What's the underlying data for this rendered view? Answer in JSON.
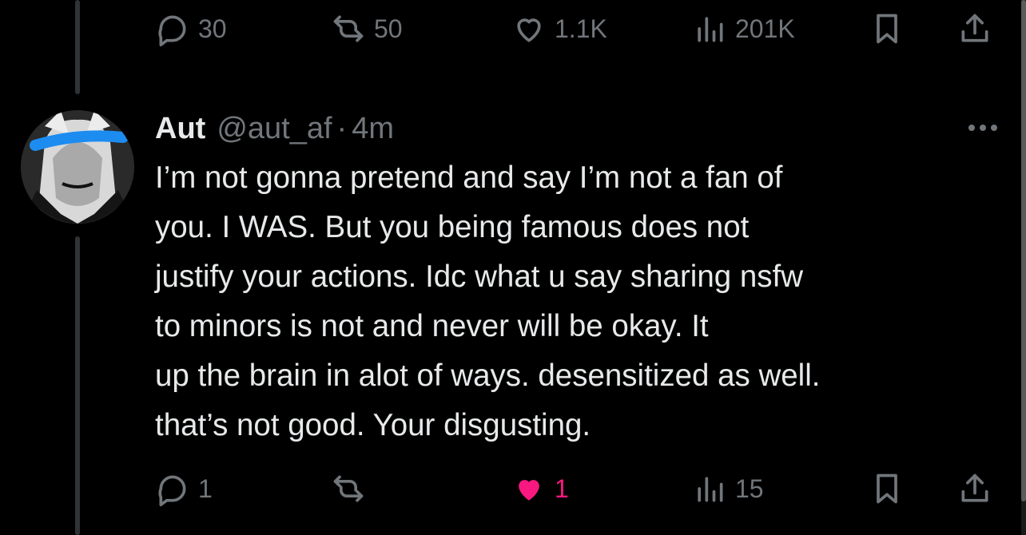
{
  "parent_actions": {
    "reply_count": "30",
    "retweet_count": "50",
    "like_count": "1.1K",
    "view_count": "201K"
  },
  "tweet": {
    "name": "Aut",
    "handle": "@aut_af",
    "separator": "·",
    "time": "4m",
    "text_lines": [
      "I’m not gonna pretend and say I’m not a fan of",
      "you. I WAS. But you being famous does not",
      "justify your actions. Idc what u say sharing nsfw",
      "to minors is not and never will be okay. It",
      "up the brain in alot of ways. desensitized as well.",
      "that’s not good. Your disgusting."
    ],
    "actions": {
      "reply_count": "1",
      "retweet_count": "",
      "like_count": "1",
      "view_count": "15",
      "liked": true
    }
  },
  "colors": {
    "background": "#000000",
    "text": "#e7e9ea",
    "muted": "#71767b",
    "like": "#f91880",
    "thread_line": "#2f3336"
  },
  "icons": [
    "reply-icon",
    "retweet-icon",
    "heart-icon",
    "views-icon",
    "bookmark-icon",
    "share-icon",
    "more-icon"
  ]
}
